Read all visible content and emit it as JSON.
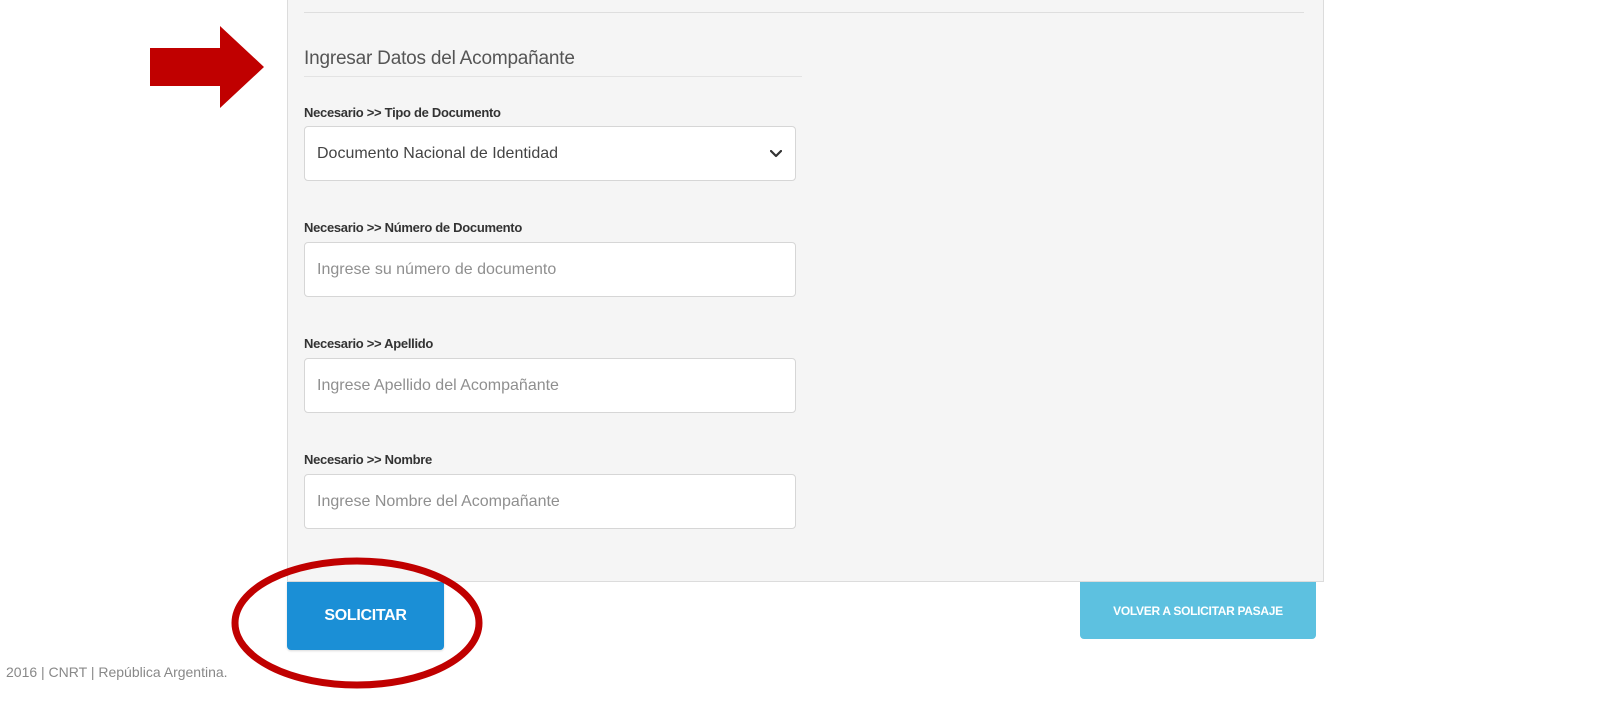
{
  "form": {
    "section_title": "Ingresar Datos del Acompañante",
    "doc_type": {
      "label": "Necesario >> Tipo de Documento",
      "selected": "Documento Nacional de Identidad"
    },
    "doc_number": {
      "label": "Necesario >> Número de Documento",
      "placeholder": "Ingrese su número de documento",
      "value": ""
    },
    "last_name": {
      "label": "Necesario >> Apellido",
      "placeholder": "Ingrese Apellido del Acompañante",
      "value": ""
    },
    "first_name": {
      "label": "Necesario >> Nombre",
      "placeholder": "Ingrese Nombre del Acompañante",
      "value": ""
    }
  },
  "actions": {
    "submit_label": "SOLICITAR",
    "back_label": "VOLVER A SOLICITAR PASAJE"
  },
  "footer": {
    "text": "2016 | CNRT | República Argentina."
  },
  "annotations": {
    "arrow_icon": "right-arrow-icon",
    "highlight_icon": "highlight-ellipse-icon",
    "color": "#c00000"
  },
  "colors": {
    "primary_button": "#1b8fd6",
    "secondary_button": "#5dc1e0",
    "panel_background": "#f5f5f5"
  }
}
